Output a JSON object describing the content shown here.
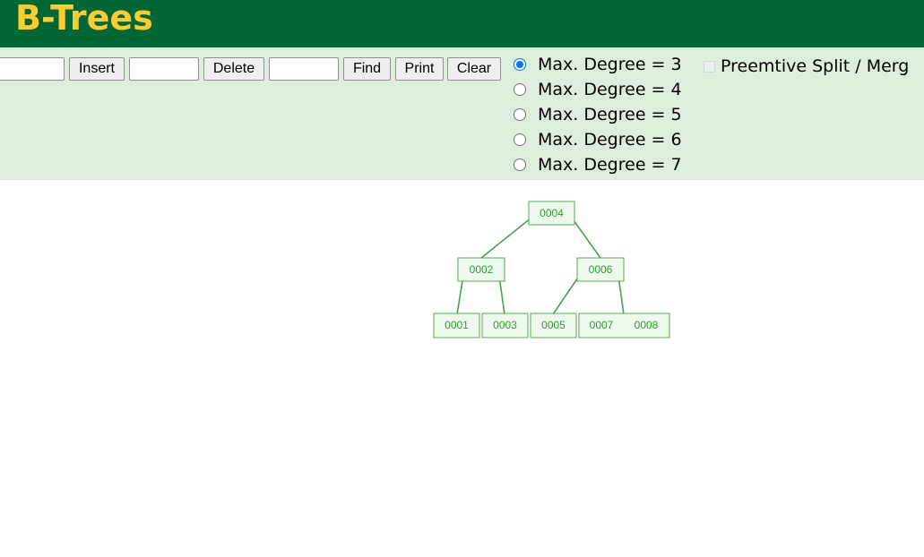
{
  "header": {
    "title": "B-Trees",
    "background_color": "#006633",
    "title_color": "#FFCC33"
  },
  "controls": {
    "background_color": "#DDEEDD",
    "insert_input": {
      "value": ""
    },
    "insert_button": "Insert",
    "delete_input": {
      "value": ""
    },
    "delete_button": "Delete",
    "find_input": {
      "value": ""
    },
    "find_button": "Find",
    "print_button": "Print",
    "clear_button": "Clear",
    "degree_options": [
      {
        "label": "Max. Degree = 3",
        "checked": true
      },
      {
        "label": "Max. Degree = 4",
        "checked": false
      },
      {
        "label": "Max. Degree = 5",
        "checked": false
      },
      {
        "label": "Max. Degree = 6",
        "checked": false
      },
      {
        "label": "Max. Degree = 7",
        "checked": false
      }
    ],
    "preemptive_checkbox": {
      "label": "Preemtive Split / Merg",
      "checked": false,
      "disabled": true
    }
  },
  "tree": {
    "node_border_color": "#55aa55",
    "node_fill_color": "#eef9ee",
    "edge_color": "#4aa04a",
    "text_color": "#339933",
    "nodes": {
      "root": [
        "0004"
      ],
      "left": [
        "0002"
      ],
      "right": [
        "0006"
      ],
      "leaf1": [
        "0001"
      ],
      "leaf2": [
        "0003"
      ],
      "leaf3": [
        "0005"
      ],
      "leaf4": [
        "0007",
        "0008"
      ]
    }
  }
}
